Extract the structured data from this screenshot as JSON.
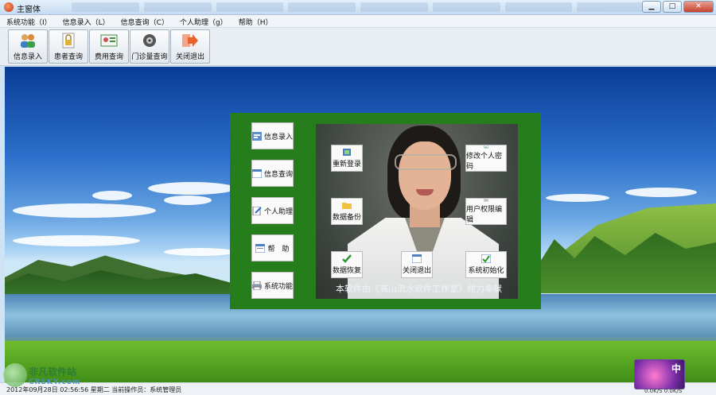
{
  "window": {
    "title": "主窗体",
    "min": "▁",
    "max": "□",
    "close": "✕"
  },
  "menu": [
    "系统功能（I）",
    "信息录入（L）",
    "信息查询（C）",
    "个人助理（g）",
    "帮助（H）"
  ],
  "toolbar": [
    {
      "label": "信息录入",
      "icon": "users-icon"
    },
    {
      "label": "患者查询",
      "icon": "document-lock-icon"
    },
    {
      "label": "费用查询",
      "icon": "id-card-icon"
    },
    {
      "label": "门诊量查询",
      "icon": "disc-camera-icon"
    },
    {
      "label": "关闭退出",
      "icon": "exit-arrow-icon"
    }
  ],
  "side_menu": [
    {
      "label": "信息录入",
      "icon": "form-edit-icon"
    },
    {
      "label": "信息查询",
      "icon": "window-search-icon"
    },
    {
      "label": "个人助理",
      "icon": "notepad-icon"
    },
    {
      "label": "帮　助",
      "icon": "help-window-icon"
    },
    {
      "label": "系统功能",
      "icon": "printer-icon"
    }
  ],
  "actions": [
    {
      "label": "重新登录",
      "icon": "login-icon"
    },
    {
      "label": "修改个人密码",
      "icon": "password-icon"
    },
    {
      "label": "数据备份",
      "icon": "folder-open-icon"
    },
    {
      "label": "用户权限编辑",
      "icon": "user-permission-icon"
    },
    {
      "label": "数据恢复",
      "icon": "check-icon"
    },
    {
      "label": "关闭退出",
      "icon": "close-window-icon"
    },
    {
      "label": "系统初始化",
      "icon": "initialize-icon"
    }
  ],
  "credit": "本软件由《高山流水软件工作室》倾力奉献",
  "status": "2012年09月28日 02:56:56 星期二 当前操作员：系统管理员",
  "watermark": {
    "title": "非凡软件站",
    "sub": "CRSKY.com"
  },
  "ime_label": "中",
  "net_speed": "0.0K/S  0.0K/S",
  "colors": {
    "panel_green": "#267d1c",
    "title_bar": "#c6dcf2",
    "desktop_sky": "#2a6fcb"
  }
}
